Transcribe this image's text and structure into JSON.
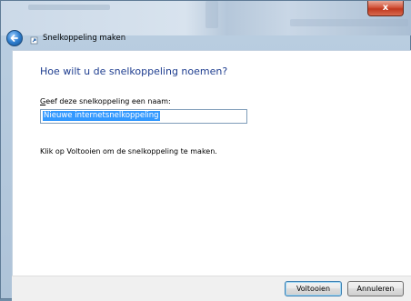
{
  "window": {
    "title": "Snelkoppeling maken",
    "close_glyph": "x"
  },
  "content": {
    "heading": "Hoe wilt u de snelkoppeling noemen?",
    "field_label": "Geef deze snelkoppeling een naam:",
    "field_label_mnemonic": "G",
    "field_label_rest": "eef deze snelkoppeling een naam:",
    "name_value": "Nieuwe internetsnelkoppeling",
    "info_text": "Klik op Voltooien om de snelkoppeling te maken."
  },
  "buttons": {
    "finish_label": "Voltooien",
    "cancel_label": "Annuleren"
  },
  "colors": {
    "heading": "#1e3d8f",
    "selection": "#3399ff",
    "close_button": "#c0381f"
  },
  "icons": [
    "back-arrow-icon",
    "shortcut-icon",
    "close-icon"
  ]
}
